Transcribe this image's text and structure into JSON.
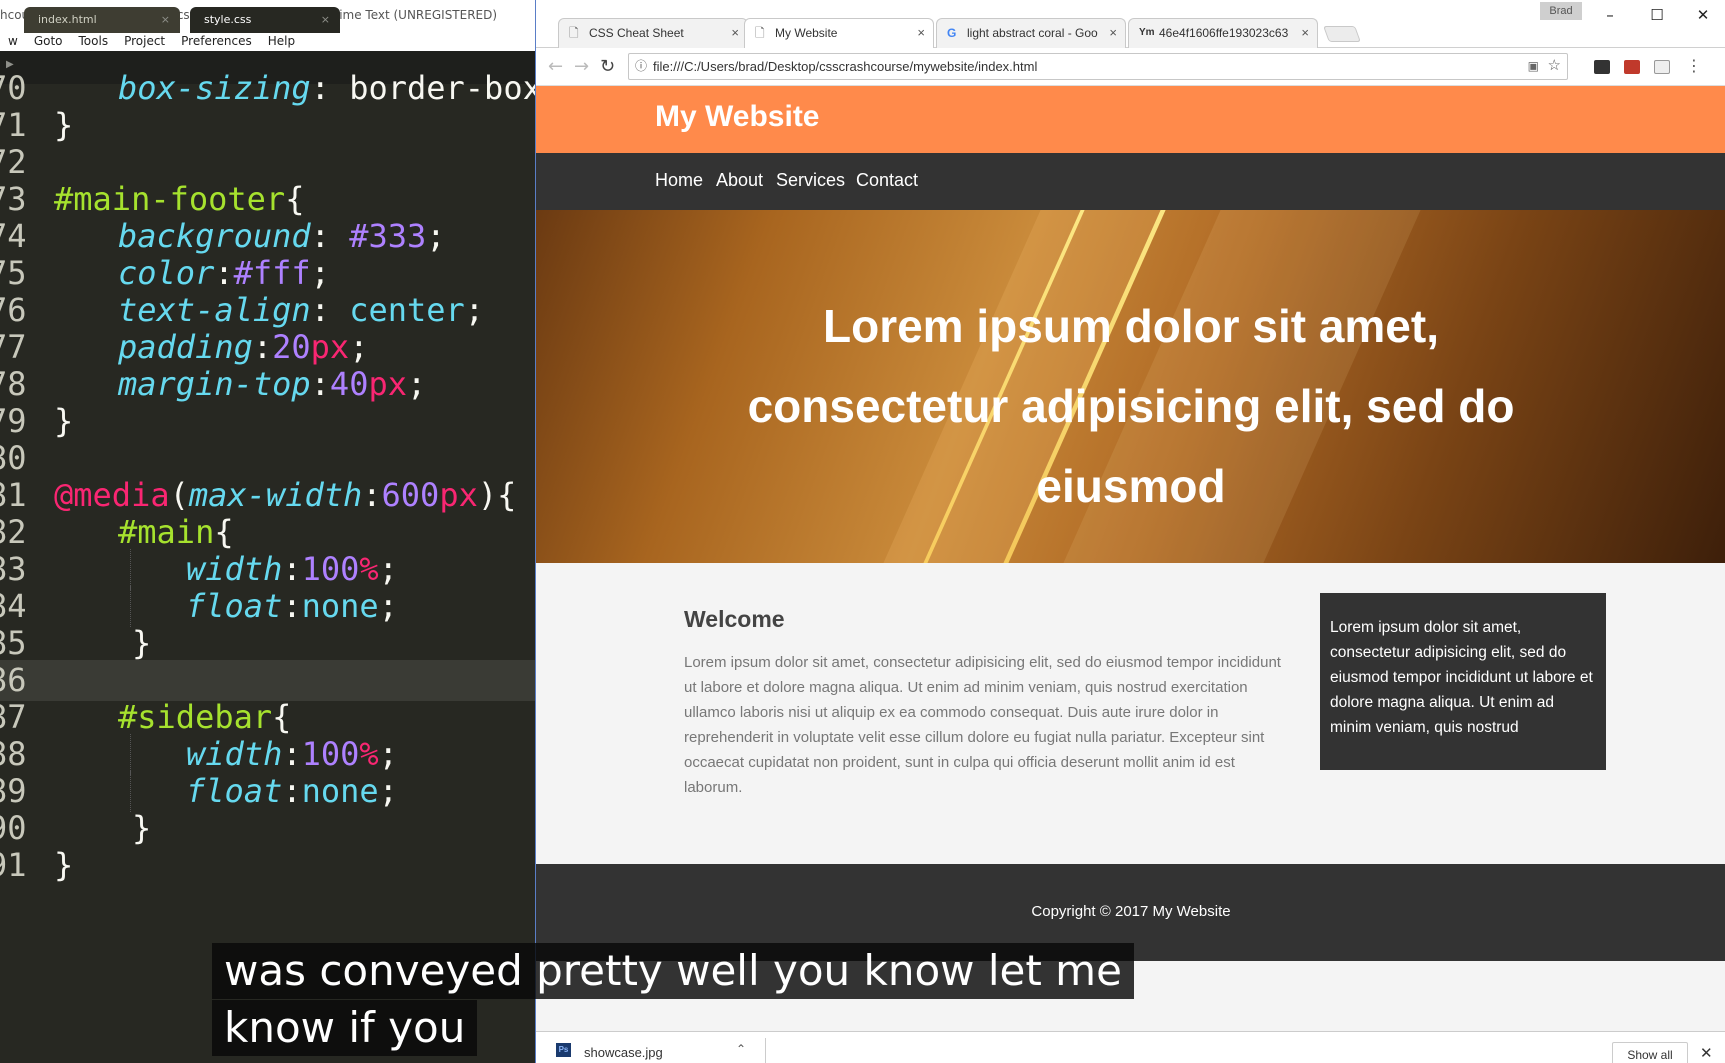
{
  "editor": {
    "title": "hcourse\\mywebsite\\css\\style.css (csscrashcourse) - Sublime Text (UNREGISTERED)",
    "menu": [
      "w",
      "Goto",
      "Tools",
      "Project",
      "Preferences",
      "Help"
    ],
    "tabs": [
      {
        "label": "index.html",
        "close": "×"
      },
      {
        "label": "style.css",
        "close": "×"
      }
    ],
    "play_icon": "▶",
    "line_numbers": [
      "70",
      "71",
      "72",
      "73",
      "74",
      "75",
      "76",
      "77",
      "78",
      "79",
      "80",
      "81",
      "82",
      "83",
      "84",
      "85",
      "86",
      "87",
      "88",
      "89",
      "90",
      "91"
    ],
    "code": {
      "l70_prop": "box-sizing",
      "l70_val": " border-box",
      "l71": "}",
      "l73_sel": "#main-footer",
      "l73_brace": "{",
      "l74_prop": "background",
      "l74_val": "#333",
      "l75_prop": "color",
      "l75_val": "#fff",
      "l76_prop": "text-align",
      "l76_val": "center",
      "l77_prop": "padding",
      "l77_num": "20",
      "l77_unit": "px",
      "l78_prop": "margin-top",
      "l78_num": "40",
      "l78_unit": "px",
      "l79": "}",
      "l81_at": "@media",
      "l81_feat": "max-width",
      "l81_num": "600",
      "l81_unit": "px",
      "l82_sel": "#main",
      "l82_brace": "{",
      "l83_prop": "width",
      "l83_num": "100",
      "l83_unit": "%",
      "l84_prop": "float",
      "l84_val": "none",
      "l85": "}",
      "l87_sel": "#sidebar",
      "l87_brace": "{",
      "l88_prop": "width",
      "l88_num": "100",
      "l88_unit": "%",
      "l89_prop": "float",
      "l89_val": "none",
      "l90": "}",
      "l91": "}"
    }
  },
  "browser": {
    "user": "Brad",
    "tabs": [
      {
        "label": "CSS Cheat Sheet",
        "icon": "🗋",
        "close": "×"
      },
      {
        "label": "My Website",
        "icon": "🗋",
        "close": "×"
      },
      {
        "label": "light abstract coral - Goo",
        "icon": "G",
        "close": "×"
      },
      {
        "label": "46e4f1606ffe193023c63",
        "icon": "Ym",
        "close": "×"
      }
    ],
    "window_controls": {
      "minimize": "–",
      "maximize": "☐",
      "close": "✕"
    },
    "nav": {
      "back": "←",
      "forward": "→",
      "reload": "↻"
    },
    "url": "file:///C:/Users/brad/Desktop/csscrashcourse/mywebsite/index.html",
    "info_icon": "ⓘ",
    "translate_icon": "▣",
    "star_icon": "☆",
    "menu_icon": "⋮"
  },
  "site": {
    "title": "My Website",
    "nav": [
      "Home",
      "About",
      "Services",
      "Contact"
    ],
    "showcase_lines": [
      "Lorem ipsum dolor sit amet,",
      "consectetur adipisicing elit, sed do",
      "eiusmod"
    ],
    "welcome_heading": "Welcome",
    "welcome_body": "Lorem ipsum dolor sit amet, consectetur adipisicing elit, sed do eiusmod tempor incididunt ut labore et dolore magna aliqua. Ut enim ad minim veniam, quis nostrud exercitation ullamco laboris nisi ut aliquip ex ea commodo consequat. Duis aute irure dolor in reprehenderit in voluptate velit esse cillum dolore eu fugiat nulla pariatur. Excepteur sint occaecat cupidatat non proident, sunt in culpa qui officia deserunt mollit anim id est laborum.",
    "sidebar_text": "Lorem ipsum dolor sit amet, consectetur adipisicing elit, sed do eiusmod tempor incididunt ut labore et dolore magna aliqua. Ut enim ad minim veniam, quis nostrud",
    "copyright": "Copyright © 2017 My Website",
    "colors": {
      "header": "#ff8a4b",
      "nav": "#333333",
      "footer": "#333333"
    }
  },
  "download": {
    "icon_label": "Ps",
    "filename": "showcase.jpg",
    "caret": "⌃",
    "show_all": "Show all",
    "close": "✕"
  },
  "captions": [
    "was conveyed pretty well you know let me",
    "know if you"
  ]
}
